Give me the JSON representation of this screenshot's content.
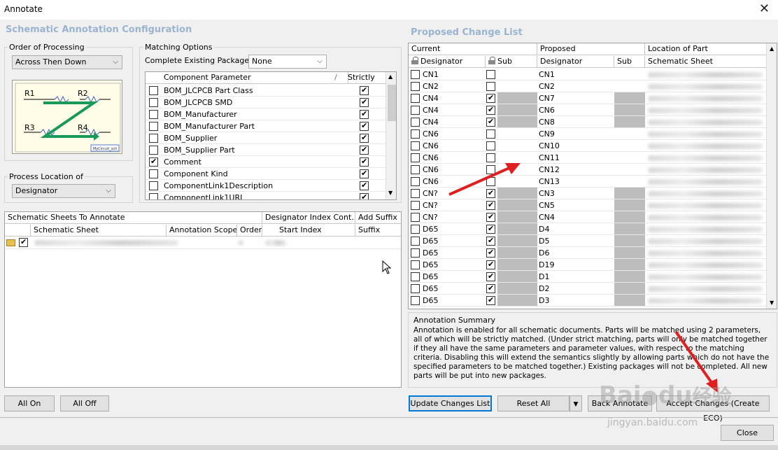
{
  "window": {
    "title": "Annotate",
    "close_glyph": "✕"
  },
  "config": {
    "title": "Schematic Annotation Configuration",
    "order_label": "Order of Processing",
    "order_value": "Across Then Down",
    "diagram": {
      "r1": "R1",
      "r2": "R2",
      "r3": "R3",
      "r4": "R4",
      "tag": "MyCircuit_sch"
    },
    "location_label": "Process Location of",
    "location_value": "Designator",
    "matching_label": "Matching Options",
    "complete_label": "Complete Existing Packages",
    "complete_value": "None",
    "param_header": "Component Parameter",
    "strictly_header": "Strictly",
    "params": [
      {
        "name": "BOM_JLCPCB Part Class",
        "checked": false,
        "strict": true
      },
      {
        "name": "BOM_JLCPCB SMD",
        "checked": false,
        "strict": true
      },
      {
        "name": "BOM_Manufacturer",
        "checked": false,
        "strict": true
      },
      {
        "name": "BOM_Manufacturer Part",
        "checked": false,
        "strict": true
      },
      {
        "name": "BOM_Supplier",
        "checked": false,
        "strict": true
      },
      {
        "name": "BOM_Supplier Part",
        "checked": false,
        "strict": true
      },
      {
        "name": "Comment",
        "checked": true,
        "strict": true
      },
      {
        "name": "Component Kind",
        "checked": false,
        "strict": true
      },
      {
        "name": "ComponentLink1Description",
        "checked": false,
        "strict": true
      },
      {
        "name": "ComponentLink1URL",
        "checked": false,
        "strict": true
      }
    ]
  },
  "sheets": {
    "header1": "Schematic Sheets To Annotate",
    "header2": "Designator Index Cont...",
    "header3": "Add Suffix",
    "cols": [
      "Schematic Sheet",
      "Annotation Scope",
      "Order",
      "Start Index",
      "Suffix"
    ]
  },
  "buttons": {
    "all_on": "All On",
    "all_off": "All Off",
    "update": "Update Changes List",
    "reset": "Reset All",
    "back": "Back Annotate",
    "accept": "Accept Changes (Create ECO)",
    "close": "Close"
  },
  "changes": {
    "title": "Proposed Change List",
    "group_current": "Current",
    "group_proposed": "Proposed",
    "group_location": "Location of Part",
    "col_designator": "Designator",
    "col_sub": "Sub",
    "col_sheet": "Schematic Sheet",
    "rows": [
      {
        "cur": "CN1",
        "locked": false,
        "prop": "CN1",
        "sub": false
      },
      {
        "cur": "CN2",
        "locked": false,
        "prop": "CN2",
        "sub": false
      },
      {
        "cur": "CN4",
        "locked": true,
        "prop": "CN7",
        "sub": true
      },
      {
        "cur": "CN4",
        "locked": true,
        "prop": "CN6",
        "sub": true
      },
      {
        "cur": "CN4",
        "locked": true,
        "prop": "CN8",
        "sub": true
      },
      {
        "cur": "CN6",
        "locked": false,
        "prop": "CN9",
        "sub": false
      },
      {
        "cur": "CN6",
        "locked": false,
        "prop": "CN10",
        "sub": false
      },
      {
        "cur": "CN6",
        "locked": false,
        "prop": "CN11",
        "sub": false
      },
      {
        "cur": "CN6",
        "locked": false,
        "prop": "CN12",
        "sub": false
      },
      {
        "cur": "CN6",
        "locked": false,
        "prop": "CN13",
        "sub": false
      },
      {
        "cur": "CN?",
        "locked": true,
        "prop": "CN3",
        "sub": true
      },
      {
        "cur": "CN?",
        "locked": true,
        "prop": "CN5",
        "sub": true
      },
      {
        "cur": "CN?",
        "locked": true,
        "prop": "CN4",
        "sub": true
      },
      {
        "cur": "D65",
        "locked": true,
        "prop": "D4",
        "sub": true
      },
      {
        "cur": "D65",
        "locked": true,
        "prop": "D5",
        "sub": true
      },
      {
        "cur": "D65",
        "locked": true,
        "prop": "D6",
        "sub": true
      },
      {
        "cur": "D65",
        "locked": true,
        "prop": "D19",
        "sub": true
      },
      {
        "cur": "D65",
        "locked": true,
        "prop": "D1",
        "sub": true
      },
      {
        "cur": "D65",
        "locked": true,
        "prop": "D2",
        "sub": true
      },
      {
        "cur": "D65",
        "locked": true,
        "prop": "D3",
        "sub": true
      }
    ]
  },
  "summary": {
    "label": "Annotation Summary",
    "text": "Annotation is enabled for all schematic documents. Parts will be matched using 2 parameters, all of which will be strictly matched. (Under strict matching, parts will only be matched together if they all have the same parameters and parameter values, with respect to the matching criteria. Disabling this will extend the semantics slightly by allowing parts which do not have the specified parameters to be matched together.) Existing packages will not be completed. All new parts will be put into new packages."
  },
  "watermark": {
    "brand": "Bai",
    "brand2": "du",
    "brand3": "经验",
    "url": "jingyan.baidu.com"
  },
  "colors": {
    "accent": "#0078d7",
    "section_title": "#9ab4d0",
    "annotation_arrow": "#e02020"
  }
}
